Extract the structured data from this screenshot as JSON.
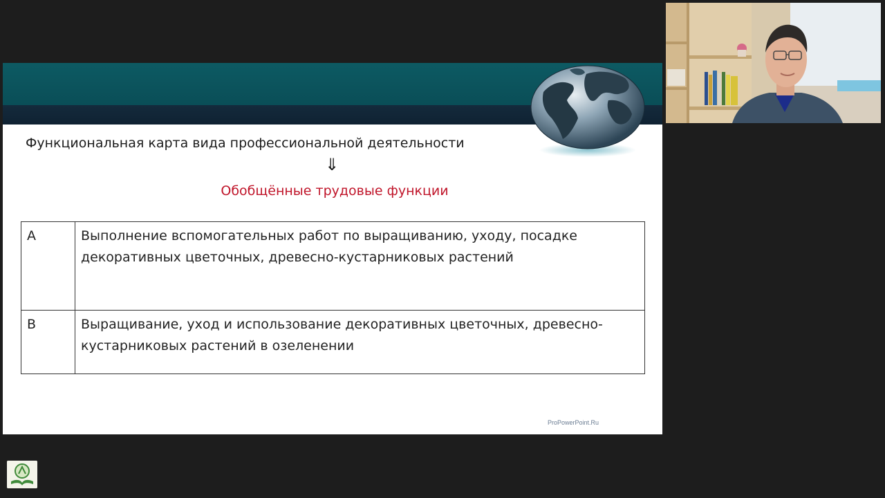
{
  "slide": {
    "title": "Функциональная карта вида профессиональной деятельности",
    "arrow": "⇓",
    "subtitle": "Обобщённые трудовые функции",
    "functions": [
      {
        "code": "A",
        "text": "Выполнение вспомогательных работ по выращиванию, уходу, посадке декоративных цветочных, древесно-кустарниковых растений"
      },
      {
        "code": "B",
        "text": "Выращивание, уход и использование декоративных цветочных, древесно-кустарниковых растений в озеленении"
      }
    ],
    "watermark": "ProPowerPoint.Ru"
  },
  "colors": {
    "teal_band": "#0d5a63",
    "navy_band": "#142a3c",
    "subtitle_red": "#c0152a",
    "background": "#1d1d1d"
  },
  "icons": {
    "globe": "globe-icon",
    "logo": "book-logo-icon"
  }
}
